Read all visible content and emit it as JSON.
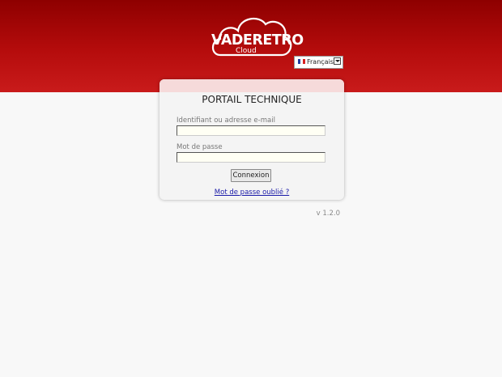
{
  "header": {
    "logo_text": "VADERETRO",
    "logo_sub": "Cloud",
    "language": {
      "selected": "Français",
      "flag_colors": [
        "#1f3da0",
        "#ffffff",
        "#d62020"
      ]
    },
    "colors": {
      "header_top": "#8e0000",
      "header_bottom": "#c91b1b"
    }
  },
  "login": {
    "title": "PORTAIL TECHNIQUE",
    "username_label": "Identifiant ou adresse e-mail",
    "username_value": "",
    "password_label": "Mot de passe",
    "password_value": "",
    "submit_label": "Connexion",
    "forgot_link": "Mot de passe oublié ?"
  },
  "footer": {
    "version": "v 1.2.0"
  }
}
